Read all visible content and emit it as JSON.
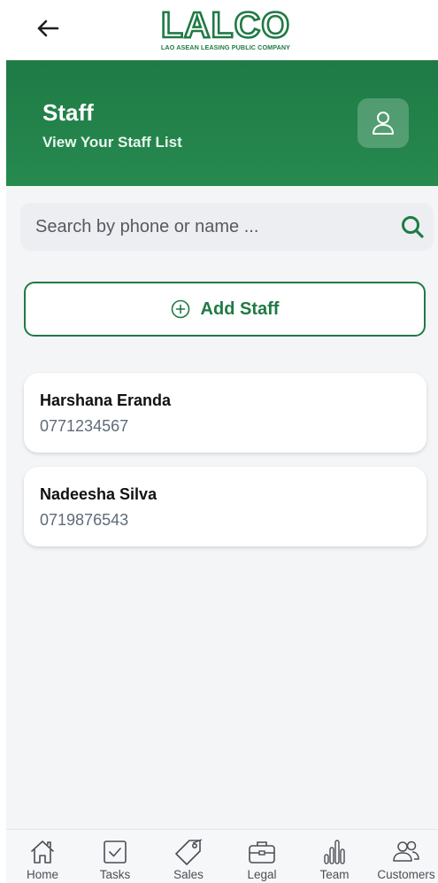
{
  "brand": {
    "logo_text": "LALCO",
    "logo_subtitle": "LAO ASEAN LEASING PUBLIC COMPANY",
    "color": "#1f7a45"
  },
  "header": {
    "title": "Staff",
    "subtitle": "View Your Staff List"
  },
  "search": {
    "placeholder": "Search by phone or name ...",
    "value": ""
  },
  "actions": {
    "add_staff_label": "Add Staff"
  },
  "staff": [
    {
      "name": "Harshana Eranda",
      "phone": "0771234567"
    },
    {
      "name": "Nadeesha Silva",
      "phone": "0719876543"
    }
  ],
  "nav": [
    {
      "label": "Home",
      "icon": "home-icon"
    },
    {
      "label": "Tasks",
      "icon": "tasks-icon"
    },
    {
      "label": "Sales",
      "icon": "tag-icon"
    },
    {
      "label": "Legal",
      "icon": "briefcase-icon"
    },
    {
      "label": "Team",
      "icon": "bar-chart-icon"
    },
    {
      "label": "Customers",
      "icon": "users-icon"
    }
  ]
}
